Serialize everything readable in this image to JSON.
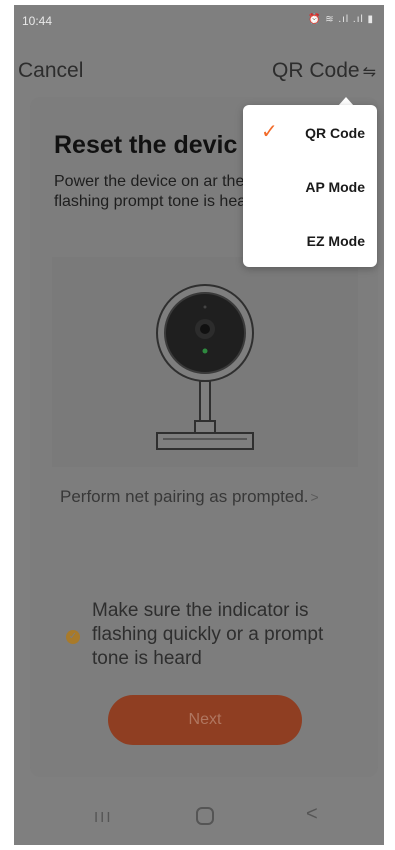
{
  "status_bar": {
    "time": "10:44",
    "icons": "⏰ ≋ .ıl .ıl ▮"
  },
  "nav": {
    "cancel": "Cancel",
    "mode": "QR Code",
    "mode_icon": "⇋"
  },
  "card": {
    "title": "Reset the devic",
    "description": "Power the device on ar the indicator is flashing prompt tone is heard",
    "pairing_link": "Perform net pairing as prompted.",
    "pairing_chevron": ">",
    "confirm_text": "Make sure the indicator is flashing quickly or a prompt tone is heard",
    "next": "Next"
  },
  "dropdown": {
    "items": [
      {
        "label": "QR Code",
        "selected": true,
        "check": "✓"
      },
      {
        "label": "AP Mode",
        "selected": false
      },
      {
        "label": "EZ Mode",
        "selected": false
      }
    ]
  },
  "system_nav": {
    "recent": "III",
    "back": "<"
  },
  "colors": {
    "accent": "#f26b2a",
    "overlay": "#7f7f7f",
    "next_button": "#8f3e22"
  }
}
